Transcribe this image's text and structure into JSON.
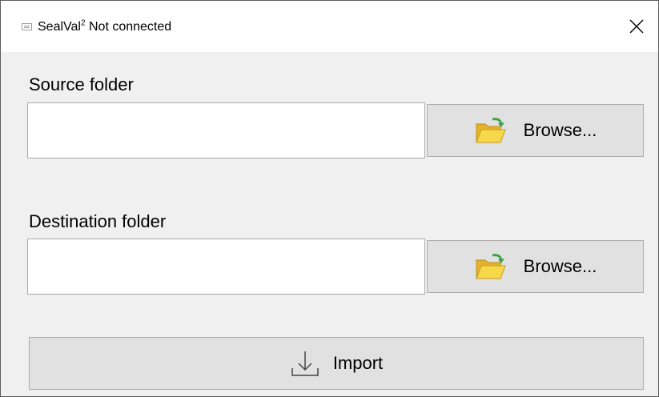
{
  "window": {
    "title": "SealVal",
    "title_superscript": "2",
    "status": "Not connected"
  },
  "source": {
    "label": "Source folder",
    "value": "",
    "browse_label": "Browse..."
  },
  "destination": {
    "label": "Destination folder",
    "value": "",
    "browse_label": "Browse..."
  },
  "import": {
    "label": "Import"
  },
  "icons": {
    "app": "app-window-icon",
    "close": "close-icon",
    "browse": "open-folder-icon",
    "import": "download-icon"
  },
  "colors": {
    "window_bg": "#f0f0f0",
    "titlebar_bg": "#ffffff",
    "button_bg": "#e1e1e1",
    "button_border": "#adadad",
    "folder_yellow": "#f5d441",
    "folder_arrow_green": "#3da34a"
  }
}
